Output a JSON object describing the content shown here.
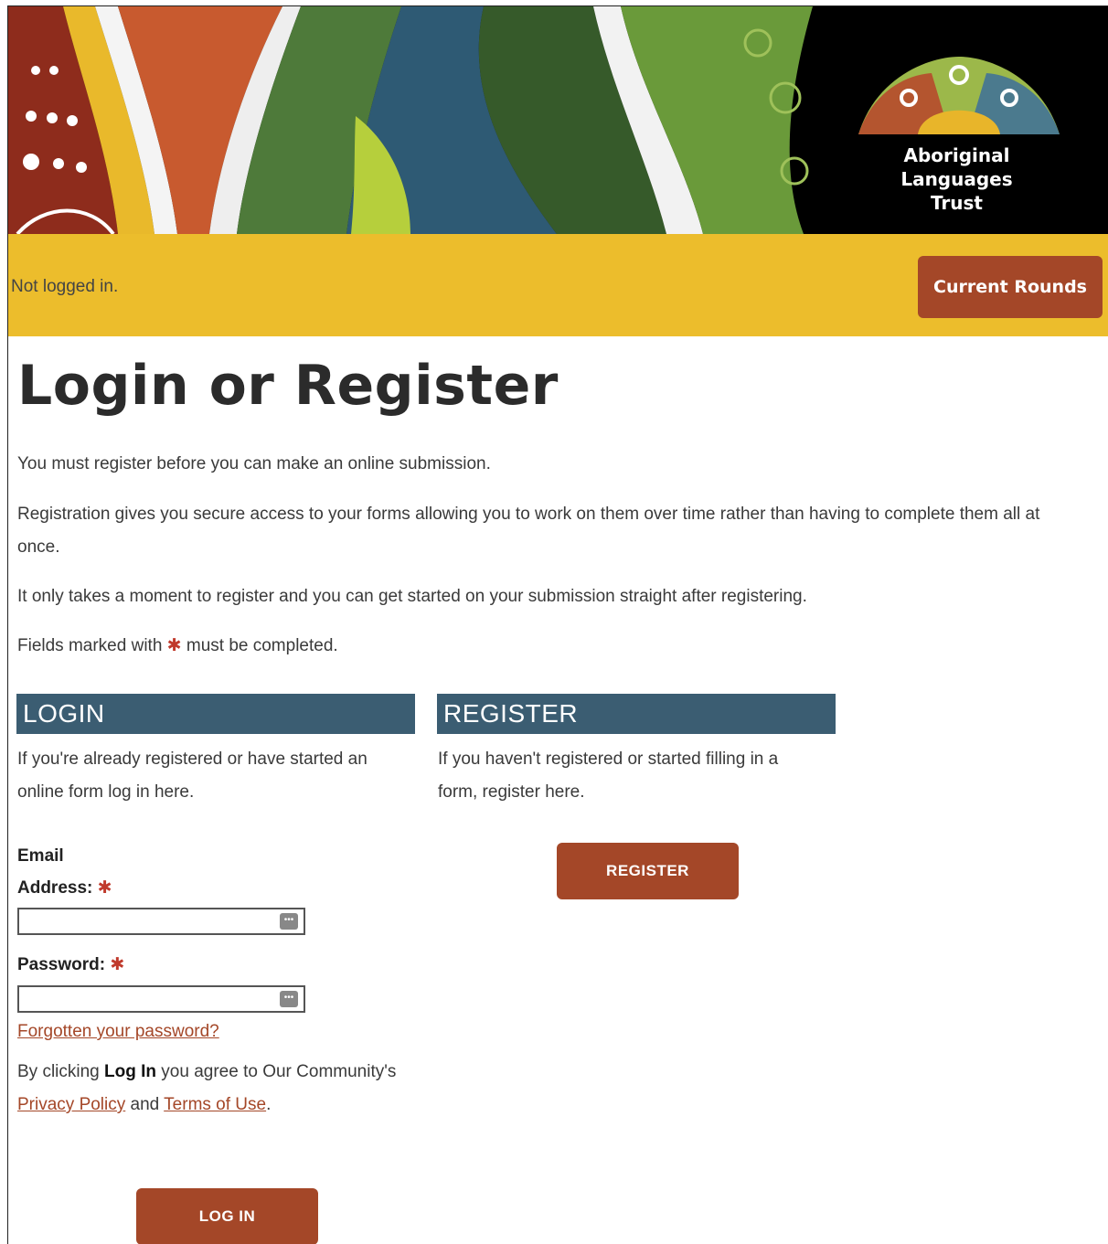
{
  "header": {
    "org_name_line1": "Aboriginal Languages",
    "org_name_line2": "Trust"
  },
  "statusbar": {
    "status": "Not logged in.",
    "rounds_label": "Current Rounds"
  },
  "page": {
    "title": "Login or Register",
    "intro1": "You must register before you can make an online submission.",
    "intro2": "Registration gives you secure access to your forms allowing you to work on them over time rather than having to complete them all at once.",
    "intro3": "It only takes a moment to register and you can get started on your submission straight after registering.",
    "fields_note_pre": "Fields marked with ",
    "fields_note_mark": "✱",
    "fields_note_post": " must be completed."
  },
  "login": {
    "heading": "LOGIN",
    "text": "If you're already registered or have started an online form log in here.",
    "email_label_1": "Email",
    "email_label_2": "Address:",
    "password_label": "Password:",
    "required_mark": "✱",
    "email_value": "",
    "password_value": "",
    "forgot_link": "Forgotten your password?",
    "agree_pre": "By clicking ",
    "agree_bold": "Log In",
    "agree_mid": " you agree to Our Community's ",
    "privacy_link": "Privacy Policy",
    "agree_and": " and ",
    "terms_link": "Terms of Use",
    "agree_end": ".",
    "button": "LOG IN"
  },
  "register": {
    "heading": "REGISTER",
    "text": "If you haven't registered or started filling in a form, register here.",
    "button": "REGISTER"
  },
  "colors": {
    "brand_button": "#a44728",
    "status_bar": "#ecbd2c",
    "section_header": "#3b5d72"
  }
}
